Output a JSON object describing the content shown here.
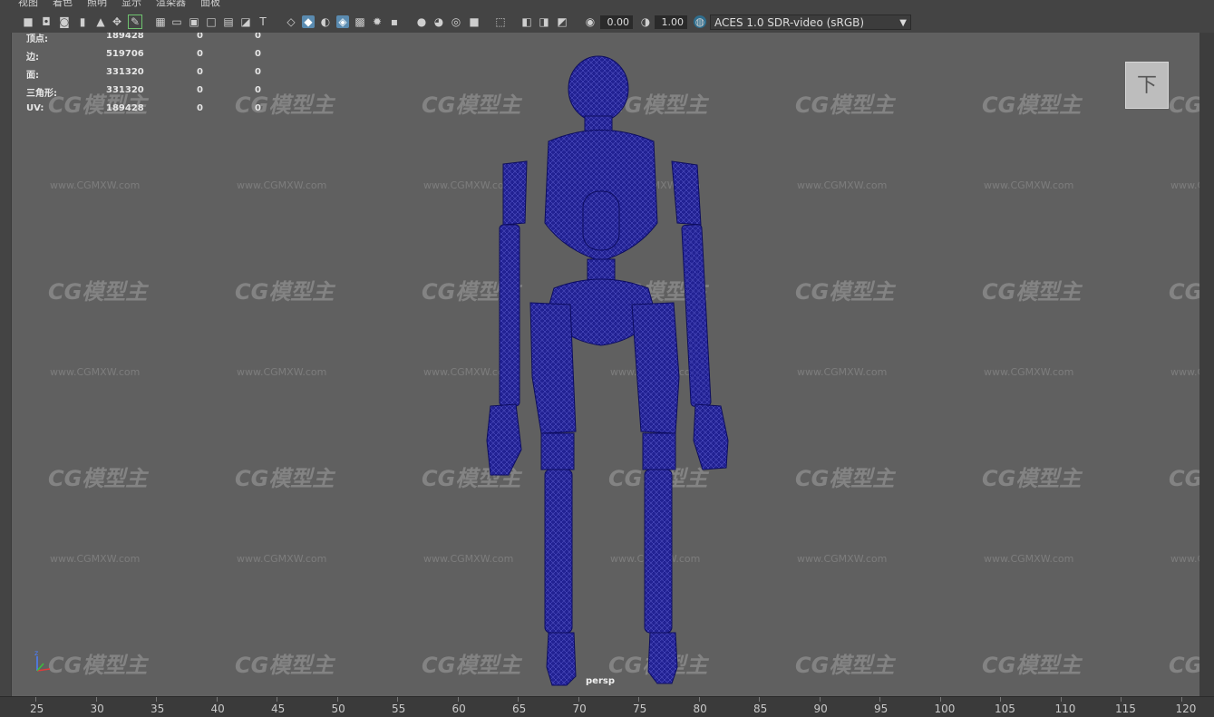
{
  "menu": [
    "视图",
    "着色",
    "照明",
    "显示",
    "渲染器",
    "面板"
  ],
  "toolbar": {
    "exposure_value": "0.00",
    "gamma_value": "1.00",
    "color_space": "ACES 1.0 SDR-video (sRGB)"
  },
  "hud": {
    "rows": [
      {
        "label": "顶点:",
        "v1": "189428",
        "v2": "0",
        "v3": "0"
      },
      {
        "label": "边:",
        "v1": "519706",
        "v2": "0",
        "v3": "0"
      },
      {
        "label": "面:",
        "v1": "331320",
        "v2": "0",
        "v3": "0"
      },
      {
        "label": "三角形:",
        "v1": "331320",
        "v2": "0",
        "v3": "0"
      },
      {
        "label": "UV:",
        "v1": "189428",
        "v2": "0",
        "v3": "0"
      }
    ]
  },
  "viewport": {
    "camera_label": "persp",
    "viewcube_face": "下",
    "axis_label": "z"
  },
  "watermark": {
    "logo": "CG模型主",
    "url": "www.CGMXW.com"
  },
  "timeline": {
    "ticks": [
      "25",
      "30",
      "35",
      "40",
      "45",
      "50",
      "55",
      "60",
      "65",
      "70",
      "75",
      "80",
      "85",
      "90",
      "95",
      "100",
      "105",
      "110",
      "115",
      "120"
    ]
  },
  "colors": {
    "mesh": "#1a1a8c",
    "viewport_bg": "#606060",
    "active_icon": "#5a8bb0"
  }
}
